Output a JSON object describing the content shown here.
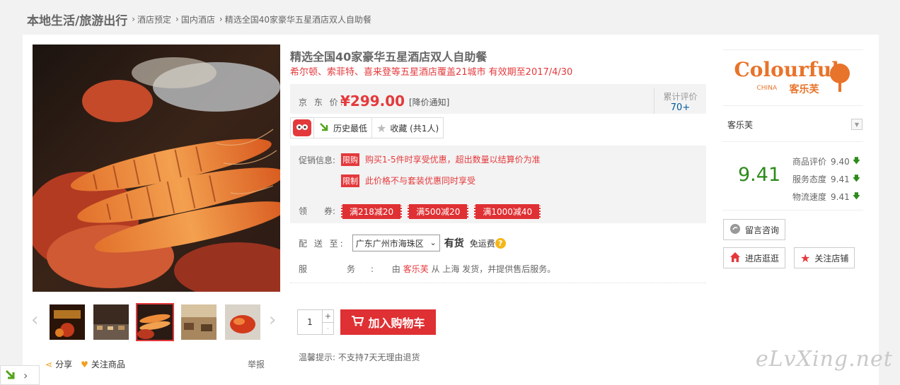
{
  "breadcrumb": {
    "root": "本地生活/旅游出行",
    "items": [
      "酒店预定",
      "国内酒店",
      "精选全国40家豪华五星酒店双人自助餐"
    ]
  },
  "gallery": {
    "thumbnails": [
      "hotel-poster",
      "buffet-hall",
      "grilled-prawns",
      "restaurant-interior",
      "lobster-dish"
    ],
    "selected_index": 2,
    "share_label": "分享",
    "follow_label": "关注商品",
    "report_label": "举报"
  },
  "product": {
    "title": "精选全国40家豪华五星酒店双人自助餐",
    "subtitle": "希尔顿、索菲特、喜来登等五星酒店覆盖21城市 有效期至2017/4/30",
    "price_label": "京 东 价:",
    "price": "¥299.00",
    "price_notify": "[降价通知]",
    "reviews_label": "累计评价",
    "reviews_count": "70+",
    "history_label": "历史最低",
    "favorite_label": "收藏 (共1人)"
  },
  "promotions": {
    "label": "促销信息:",
    "items": [
      {
        "tag": "限购",
        "text": "购买1-5件时享受优惠，超出数量以结算价为准"
      },
      {
        "tag": "限制",
        "text": "此价格不与套装优惠同时享受"
      }
    ],
    "coupon_label": "领　　券:",
    "coupons": [
      "满218减20",
      "满500减20",
      "满1000减40"
    ]
  },
  "delivery": {
    "label": "配 送 至:",
    "region": "广东广州市海珠区",
    "stock": "有货",
    "shipping": "免运费"
  },
  "service": {
    "label": "服　务:",
    "prefix": "由",
    "shop": "客乐芙",
    "suffix": "从 上海 发货，并提供售后服务。"
  },
  "purchase": {
    "quantity": "1",
    "plus": "+",
    "minus": "-",
    "cart_label": "加入购物车",
    "tip": "温馨提示: 不支持7天无理由退货"
  },
  "shop": {
    "logo_text": "Colourful",
    "logo_sub": "CHINA",
    "logo_cn": "客乐芙",
    "name": "客乐芙",
    "score": "9.41",
    "ratings": [
      {
        "label": "商品评价",
        "value": "9.40"
      },
      {
        "label": "服务态度",
        "value": "9.41"
      },
      {
        "label": "物流速度",
        "value": "9.41"
      }
    ],
    "consult_label": "留言咨询",
    "visit_label": "进店逛逛",
    "follow_label": "关注店铺"
  },
  "watermark": "eLvXing.net",
  "colors": {
    "accent": "#e4393c",
    "score": "#2c8b1a",
    "link": "#005aa0"
  }
}
